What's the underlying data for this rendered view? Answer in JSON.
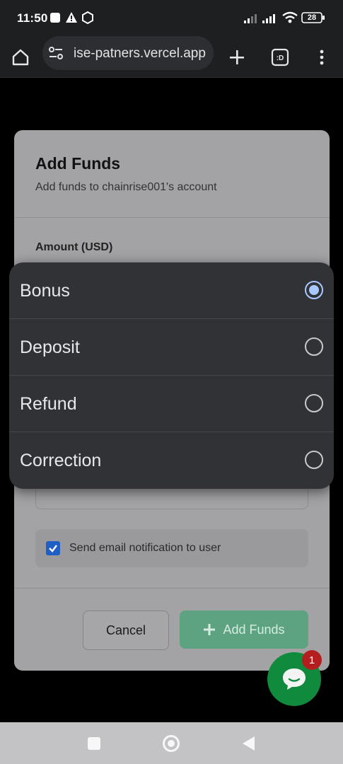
{
  "status_bar": {
    "time": "11:50",
    "battery": "28"
  },
  "browser": {
    "url": "ise-patners.vercel.app"
  },
  "modal": {
    "title": "Add Funds",
    "subtitle": "Add funds to chainrise001's account",
    "amount_label": "Amount (USD)",
    "notify_label": "Send email notification to user",
    "notify_checked": true,
    "cancel_label": "Cancel",
    "submit_label": "Add Funds"
  },
  "dropdown": {
    "options": [
      {
        "label": "Bonus",
        "selected": true
      },
      {
        "label": "Deposit",
        "selected": false
      },
      {
        "label": "Refund",
        "selected": false
      },
      {
        "label": "Correction",
        "selected": false
      }
    ]
  },
  "chat": {
    "badge_count": "1"
  },
  "icons": {
    "home": "home-icon",
    "site_settings": "tune-icon",
    "new_tab": "plus-icon",
    "tabs": "tab-switcher-icon",
    "menu": "more-vert-icon"
  },
  "colors": {
    "accent_green": "#108b3d",
    "submit_green": "#5da382",
    "radio_selected": "#a9c7ff",
    "badge_red": "#b51e1e"
  }
}
